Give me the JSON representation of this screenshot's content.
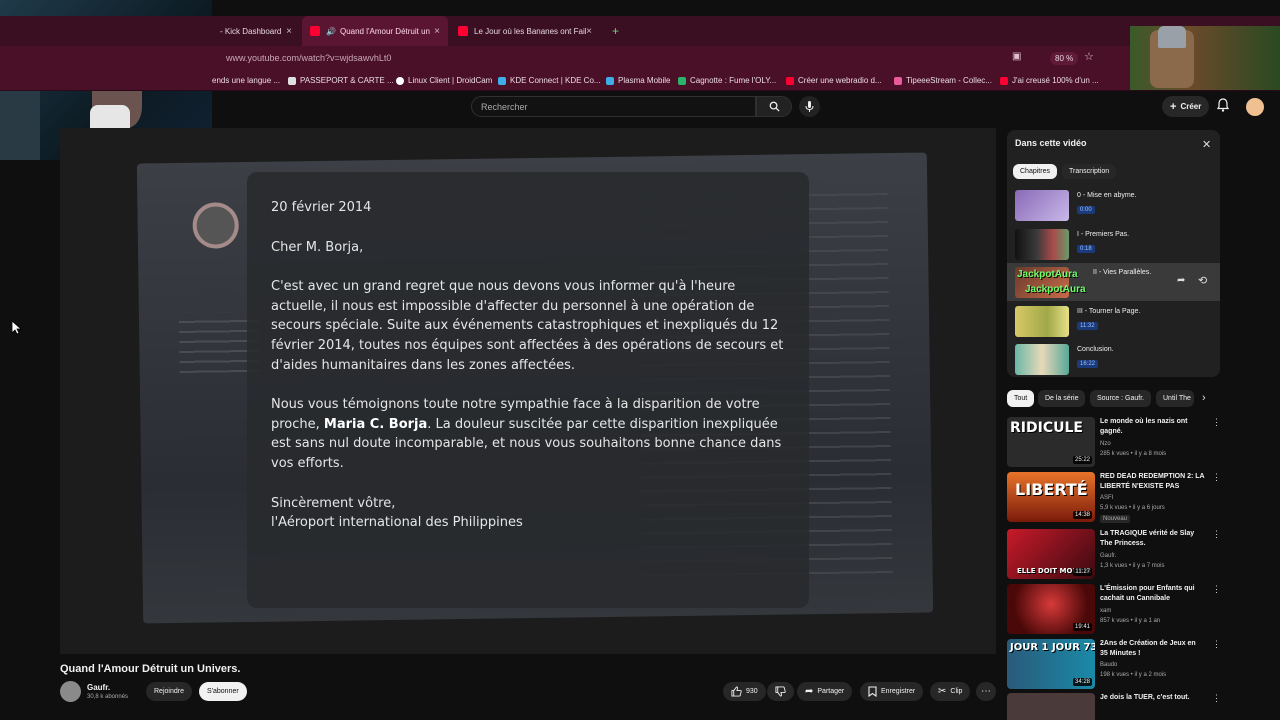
{
  "browser": {
    "tabs": [
      {
        "label": "- Kick Dashboard"
      },
      {
        "label": "Quand l'Amour Détruit un U"
      },
      {
        "label": "Le Jour où les Bananes ont Faill"
      }
    ],
    "url": "www.youtube.com/watch?v=wjdsawvhLt0",
    "zoom": "80 %",
    "bookmarks": [
      "ends une langue ...",
      "PASSEPORT & CARTE ...",
      "Linux Client | DroidCam",
      "KDE Connect | KDE Co...",
      "Plasma Mobile",
      "Cagnotte : Fume l'OLY...",
      "Créer une webradio d...",
      "TipeeeStream - Collec...",
      "J'ai creusé 100% d'un ..."
    ]
  },
  "header": {
    "search_placeholder": "Rechercher",
    "create_label": "Créer"
  },
  "letter": {
    "date": "20 février 2014",
    "salutation": "Cher M. Borja,",
    "p1": "C'est avec un grand regret que nous devons vous informer qu'à l'heure actuelle, il nous est impossible d'affecter du personnel à une opération de secours spéciale. Suite aux événements catastrophiques et inexpliqués du 12 février 2014, toutes nos équipes sont affectées à des opérations de secours et d'aides humanitaires dans les zones affectées.",
    "p2_a": "Nous vous témoignons toute notre sympathie face à la disparition de votre proche, ",
    "p2_name": "Maria C. Borja",
    "p2_b": ". La douleur suscitée par cette disparition inexpliquée est sans nul doute incomparable, et nous vous souhaitons bonne chance dans vos efforts.",
    "closing": "Sincèrement vôtre,",
    "signature": "l'Aéroport international des Philippines"
  },
  "video": {
    "title": "Quand l'Amour Détruit un Univers.",
    "channel": "Gaufr.",
    "subscribers": "30,8 k abonnés",
    "join_label": "Rejoindre",
    "subscribe_label": "S'abonner",
    "likes": "930",
    "share_label": "Partager",
    "save_label": "Enregistrer",
    "clip_label": "Clip"
  },
  "chapters": {
    "title": "Dans cette vidéo",
    "tab_chapters": "Chapitres",
    "tab_transcript": "Transcription",
    "items": [
      {
        "label": "0 - Mise en abyme.",
        "time": "0:00"
      },
      {
        "label": "I - Premiers Pas.",
        "time": "0:18"
      },
      {
        "label": "II - Vies Parallèles.",
        "overlay": "JackpotAura"
      },
      {
        "label": "III - Tourner la Page.",
        "time": "11:32"
      },
      {
        "label": "Conclusion.",
        "time": "16:22"
      }
    ]
  },
  "chips": [
    "Tout",
    "De la série",
    "Source : Gaufr.",
    "Until The"
  ],
  "recommendations": [
    {
      "thumb_text": "RIDICULE",
      "duration": "25:22",
      "title": "Le monde où les nazis ont gagné.",
      "channel": "Nzo",
      "meta": "285 k vues • il y a 8 mois",
      "color": "#3a3a3a"
    },
    {
      "thumb_text": "LIBERTÉ",
      "duration": "14:38",
      "title": "RED DEAD REDEMPTION 2: LA LIBERTÉ N'EXISTE PAS",
      "channel": "ASFI",
      "meta": "5,9 k vues • il y a 6 jours",
      "badge": "Nouveau",
      "color": "#b83a10"
    },
    {
      "thumb_text": "ELLE DOIT MOURIR",
      "duration": "11:27",
      "title": "La TRAGIQUE vérité de Slay The Princess.",
      "channel": "Gaufr.",
      "meta": "1,3 k vues • il y a 7 mois",
      "color": "#8a1020"
    },
    {
      "thumb_text": "",
      "duration": "19:41",
      "title": "L'Émission pour Enfants qui cachait un Cannibale",
      "channel": "xam",
      "meta": "857 k vues • il y a 1 an",
      "color": "#7a0e0e"
    },
    {
      "thumb_text": "JOUR 1  JOUR 730",
      "duration": "34:28",
      "title": "2Ans de Création de Jeux en 35 Minutes !",
      "channel": "Baudo",
      "meta": "198 k vues • il y a 2 mois",
      "color": "#1a6a8a"
    },
    {
      "thumb_text": "",
      "duration": "",
      "title": "Je dois la TUER, c'est tout.",
      "channel": "",
      "meta": "",
      "color": "#4a3a3a"
    }
  ]
}
